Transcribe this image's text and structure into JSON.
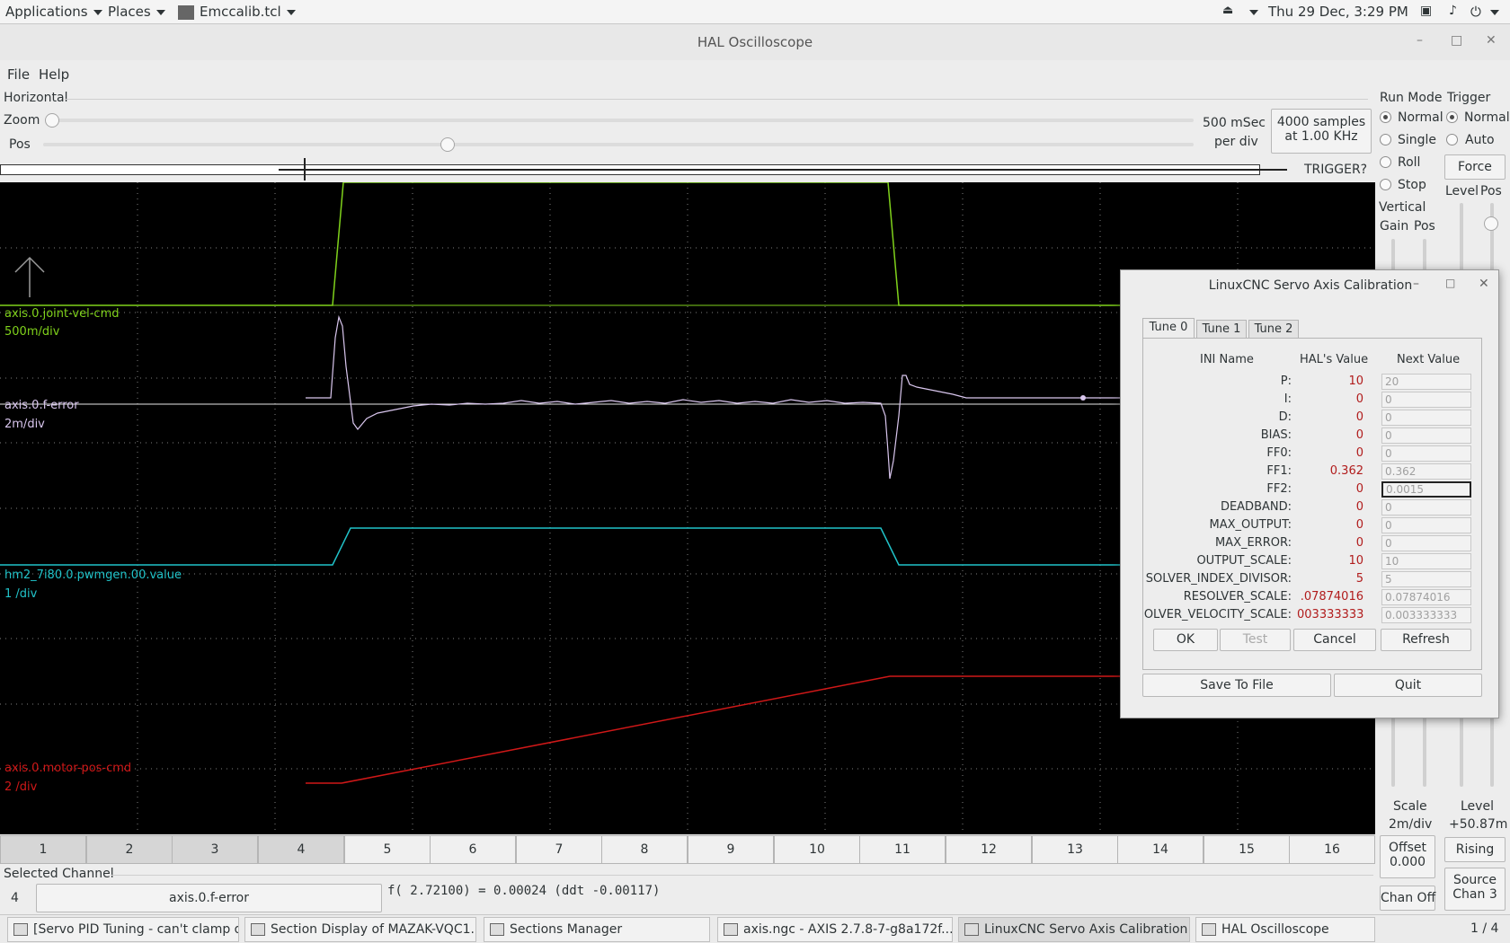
{
  "topbar": {
    "applications": "Applications",
    "places": "Places",
    "app_menu": "Emccalib.tcl",
    "clock": "Thu 29 Dec,  3:29 PM",
    "workspace": "1 / 4"
  },
  "window": {
    "title": "HAL Oscilloscope"
  },
  "menu": {
    "file": "File",
    "help": "Help"
  },
  "horizontal": {
    "title": "Horizontal",
    "zoom_label": "Zoom",
    "pos_label": "Pos",
    "zoom_value": 0.0,
    "pos_value": 0.35,
    "timebase_line1": "500 mSec",
    "timebase_line2": "per div",
    "samples_line1": "4000 samples",
    "samples_line2": "at 1.00 KHz",
    "trigger_status": "TRIGGER?"
  },
  "run_mode": {
    "title": "Run Mode",
    "options": [
      {
        "label": "Normal",
        "selected": true
      },
      {
        "label": "Single",
        "selected": false
      },
      {
        "label": "Roll",
        "selected": false
      },
      {
        "label": "Stop",
        "selected": false
      }
    ]
  },
  "trigger": {
    "title": "Trigger",
    "options": [
      {
        "label": "Normal",
        "selected": true
      },
      {
        "label": "Auto",
        "selected": false
      }
    ],
    "force_label": "Force",
    "level_label": "Level",
    "pos_label": "Pos",
    "level_title": "Level",
    "level_value": "+50.87m",
    "edge_label": "Rising",
    "source_label": "Source",
    "source_value": "Chan  3"
  },
  "vertical": {
    "title": "Vertical",
    "gain_label": "Gain",
    "pos_label": "Pos",
    "scale_label": "Scale",
    "scale_value": "2m/div",
    "offset_label": "Offset",
    "offset_value": "0.000",
    "chan_off_label": "Chan Off"
  },
  "scope": {
    "colors": {
      "ch1": "#7fd11b",
      "ch2": "#d9c6ee",
      "ch3": "#21c3c9",
      "ch4": "#d01818",
      "grid": "#808080"
    },
    "traces": [
      {
        "name": "axis.0.joint-vel-cmd",
        "scale": "500m/div"
      },
      {
        "name": "axis.0.f-error",
        "scale": "2m/div"
      },
      {
        "name": "hm2_7i80.0.pwmgen.00.value",
        "scale": "1 /div"
      },
      {
        "name": "axis.0.motor-pos-cmd",
        "scale": "2 /div"
      }
    ]
  },
  "channels": {
    "buttons": [
      "1",
      "2",
      "3",
      "4",
      "5",
      "6",
      "7",
      "8",
      "9",
      "10",
      "11",
      "12",
      "13",
      "14",
      "15",
      "16"
    ],
    "selected_index": 3
  },
  "selected_channel": {
    "title": "Selected Channel",
    "number": "4",
    "name": "axis.0.f-error",
    "readout": "f( 2.72100) =  0.00024 (ddt -0.00117)"
  },
  "dialog": {
    "title": "LinuxCNC Servo Axis Calibration",
    "tabs": [
      "Tune 0",
      "Tune 1",
      "Tune 2"
    ],
    "active_tab": 0,
    "headers": {
      "name": "INI Name",
      "hal": "HAL's Value",
      "next": "Next Value"
    },
    "rows": [
      {
        "name": "P:",
        "hal": "10",
        "next": "20"
      },
      {
        "name": "I:",
        "hal": "0",
        "next": "0"
      },
      {
        "name": "D:",
        "hal": "0",
        "next": "0"
      },
      {
        "name": "BIAS:",
        "hal": "0",
        "next": "0"
      },
      {
        "name": "FF0:",
        "hal": "0",
        "next": "0"
      },
      {
        "name": "FF1:",
        "hal": "0.362",
        "next": "0.362"
      },
      {
        "name": "FF2:",
        "hal": "0",
        "next": "0.0015"
      },
      {
        "name": "DEADBAND:",
        "hal": "0",
        "next": "0"
      },
      {
        "name": "MAX_OUTPUT:",
        "hal": "0",
        "next": "0"
      },
      {
        "name": "MAX_ERROR:",
        "hal": "0",
        "next": "0"
      },
      {
        "name": "OUTPUT_SCALE:",
        "hal": "10",
        "next": "10"
      },
      {
        "name": "SOLVER_INDEX_DIVISOR:",
        "hal": "5",
        "next": "5"
      },
      {
        "name": "RESOLVER_SCALE:",
        "hal": ".07874016",
        "next": "0.07874016"
      },
      {
        "name": "OLVER_VELOCITY_SCALE:",
        "hal": "003333333",
        "next": "0.003333333"
      }
    ],
    "buttons": {
      "ok": "OK",
      "test": "Test",
      "cancel": "Cancel",
      "refresh": "Refresh",
      "save": "Save To File",
      "quit": "Quit"
    }
  },
  "taskbar": [
    {
      "label": "[Servo PID Tuning - can't clamp d...",
      "active": false
    },
    {
      "label": "Section Display of MAZAK-VQC1...",
      "active": false
    },
    {
      "label": "Sections Manager",
      "active": false
    },
    {
      "label": "axis.ngc - AXIS 2.7.8-7-g8a172f...",
      "active": false
    },
    {
      "label": "LinuxCNC Servo Axis Calibration",
      "active": true
    },
    {
      "label": "HAL Oscilloscope",
      "active": false
    }
  ]
}
